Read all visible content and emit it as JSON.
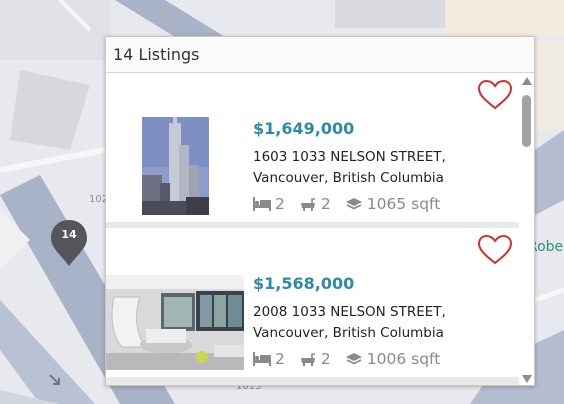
{
  "map": {
    "labels": [
      "102",
      "Robe",
      "1015"
    ],
    "marker_count": "14"
  },
  "popup": {
    "title": "14 Listings"
  },
  "listings": [
    {
      "price": "$1,649,000",
      "address_line1": "1603 1033 NELSON STREET,",
      "address_line2": "Vancouver, British Columbia",
      "beds": "2",
      "baths": "2",
      "sqft": "1065 sqft"
    },
    {
      "price": "$1,568,000",
      "address_line1": "2008 1033 NELSON STREET,",
      "address_line2": "Vancouver, British Columbia",
      "beds": "2",
      "baths": "2",
      "sqft": "1006 sqft"
    }
  ],
  "colors": {
    "price": "#2e8ba6",
    "heart": "#d32f2f",
    "marker": "#55565c",
    "map_street": "#a7b2c6"
  },
  "icons": [
    "heart-icon",
    "bed-icon",
    "bath-icon",
    "layers-icon",
    "map-marker-icon",
    "scroll-up-icon",
    "scroll-down-icon"
  ]
}
